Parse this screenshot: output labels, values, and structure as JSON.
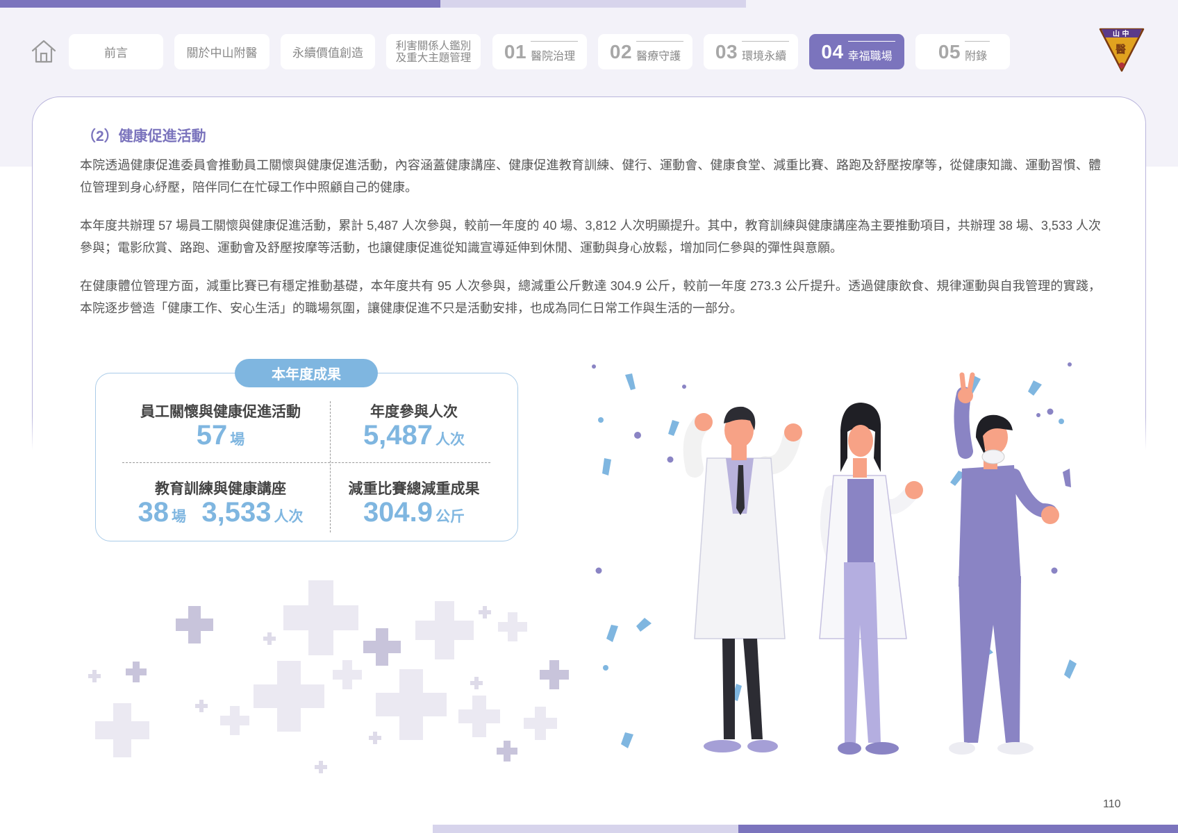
{
  "nav": {
    "tabs": [
      {
        "label": "前言"
      },
      {
        "label": "關於中山附醫"
      },
      {
        "label": "永續價值創造"
      },
      {
        "label_line1": "利害關係人鑑別",
        "label_line2": "及重大主題管理"
      },
      {
        "num": "01",
        "label": "醫院治理"
      },
      {
        "num": "02",
        "label": "醫療守護"
      },
      {
        "num": "03",
        "label": "環境永續"
      },
      {
        "num": "04",
        "label": "幸福職場",
        "active": true
      },
      {
        "num": "05",
        "label": "附錄"
      }
    ],
    "logo_text": "山 中 醫"
  },
  "section": {
    "title": "（2）健康促進活動",
    "paragraphs": [
      "本院透過健康促進委員會推動員工關懷與健康促進活動，內容涵蓋健康講座、健康促進教育訓練、健行、運動會、健康食堂、減重比賽、路跑及舒壓按摩等，從健康知識、運動習慣、體位管理到身心紓壓，陪伴同仁在忙碌工作中照顧自己的健康。",
      "本年度共辦理 57 場員工關懷與健康促進活動，累計 5,487 人次參與，較前一年度的 40 場、3,812 人次明顯提升。其中，教育訓練與健康講座為主要推動項目，共辦理 38 場、3,533 人次參與；電影欣賞、路跑、運動會及舒壓按摩等活動，也讓健康促進從知識宣導延伸到休閒、運動與身心放鬆，增加同仁參與的彈性與意願。",
      "在健康體位管理方面，減重比賽已有穩定推動基礎，本年度共有 95 人次參與，總減重公斤數達 304.9 公斤，較前一年度 273.3 公斤提升。透過健康飲食、規律運動與自我管理的實踐，本院逐步營造「健康工作、安心生活」的職場氛圍，讓健康促進不只是活動安排，也成為同仁日常工作與生活的一部分。"
    ]
  },
  "stats": {
    "badge": "本年度成果",
    "items": [
      {
        "label": "員工關懷與健康促進活動",
        "value": "57",
        "unit": "場"
      },
      {
        "label": "年度參與人次",
        "value": "5,487",
        "unit": "人次"
      },
      {
        "label": "教育訓練與健康講座",
        "value": "38",
        "unit": "場",
        "value2": "3,533",
        "unit2": "人次"
      },
      {
        "label": "減重比賽總減重成果",
        "value": "304.9",
        "unit": "公斤"
      }
    ]
  },
  "page_number": "110",
  "colors": {
    "accent": "#7b74bd",
    "stat_blue": "#7fb6e0",
    "panel_border": "#b9b5dc",
    "top_bg": "#f3f2f9"
  }
}
